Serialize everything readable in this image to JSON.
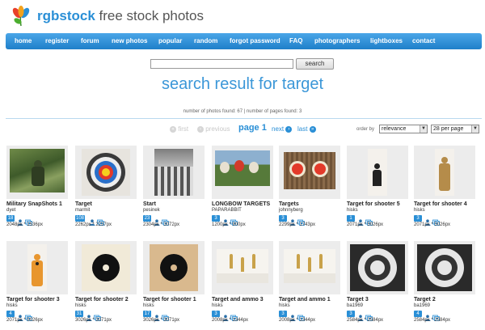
{
  "brand": {
    "name_bold": "rgbstock",
    "name_rest": " free stock photos"
  },
  "nav": [
    "home",
    "register",
    "forum",
    "new photos",
    "popular",
    "random",
    "forgot password",
    "FAQ",
    "photographers",
    "lightboxes",
    "contact"
  ],
  "search": {
    "value": "",
    "button": "search"
  },
  "result_title": "search result for target",
  "count_line": "number of photos found: 67 | number of pages found: 3",
  "pagination": {
    "first": "first",
    "previous": "previous",
    "current": "page 1",
    "next": "next",
    "last": "last"
  },
  "order": {
    "label": "order by",
    "selected": "relevance",
    "per_page": "28 per page"
  },
  "colors": {
    "accent": "#2a8fd6",
    "nav": "#2c8ad4",
    "title": "#3b97d8"
  },
  "photos": [
    {
      "title": "Military SnapShots 1",
      "user": "dyet",
      "count": "18",
      "dims": "2048px * 1536px",
      "kind": "soldier"
    },
    {
      "title": "Target",
      "user": "marmit",
      "count": "108",
      "dims": "2262px * 2237px",
      "kind": "bullseye"
    },
    {
      "title": "Start",
      "user": "pesinek",
      "count": "23",
      "dims": "2304px * 3072px",
      "kind": "crosswalk"
    },
    {
      "title": "LONGBOW TARGETS",
      "user": "PAPARABBIT",
      "count": "3",
      "dims": "1200px * 900px",
      "kind": "longbow"
    },
    {
      "title": "Targets",
      "user": "johnnyberg",
      "count": "3",
      "dims": "2299px * 1743px",
      "kind": "targets-wall"
    },
    {
      "title": "Target for shooter 5",
      "user": "hisks",
      "count": "1",
      "dims": "2071px * 5026px",
      "kind": "silhouette-black"
    },
    {
      "title": "Target for shooter 4",
      "user": "hisks",
      "count": "3",
      "dims": "2071px * 5026px",
      "kind": "silhouette-tan"
    },
    {
      "title": "Target for shooter 3",
      "user": "hisks",
      "count": "4",
      "dims": "2071px * 5026px",
      "kind": "silhouette-orange"
    },
    {
      "title": "Target for shooter 2",
      "user": "hisks",
      "count": "31",
      "dims": "3026px * 3071px",
      "kind": "paper-target"
    },
    {
      "title": "Target for shooter 1",
      "user": "hisks",
      "count": "17",
      "dims": "3026px * 3071px",
      "kind": "paper-target-brown"
    },
    {
      "title": "Target and ammo 3",
      "user": "hisks",
      "count": "3",
      "dims": "2008px * 1344px",
      "kind": "ammo"
    },
    {
      "title": "Target and ammo 1",
      "user": "hisks",
      "count": "3",
      "dims": "2008px * 1344px",
      "kind": "ammo"
    },
    {
      "title": "Target 3",
      "user": "ba1969",
      "count": "3",
      "dims": "2584px * 2584px",
      "kind": "grunge-target"
    },
    {
      "title": "Target 2",
      "user": "ba1969",
      "count": "4",
      "dims": "2584px * 2584px",
      "kind": "grunge-target"
    }
  ]
}
